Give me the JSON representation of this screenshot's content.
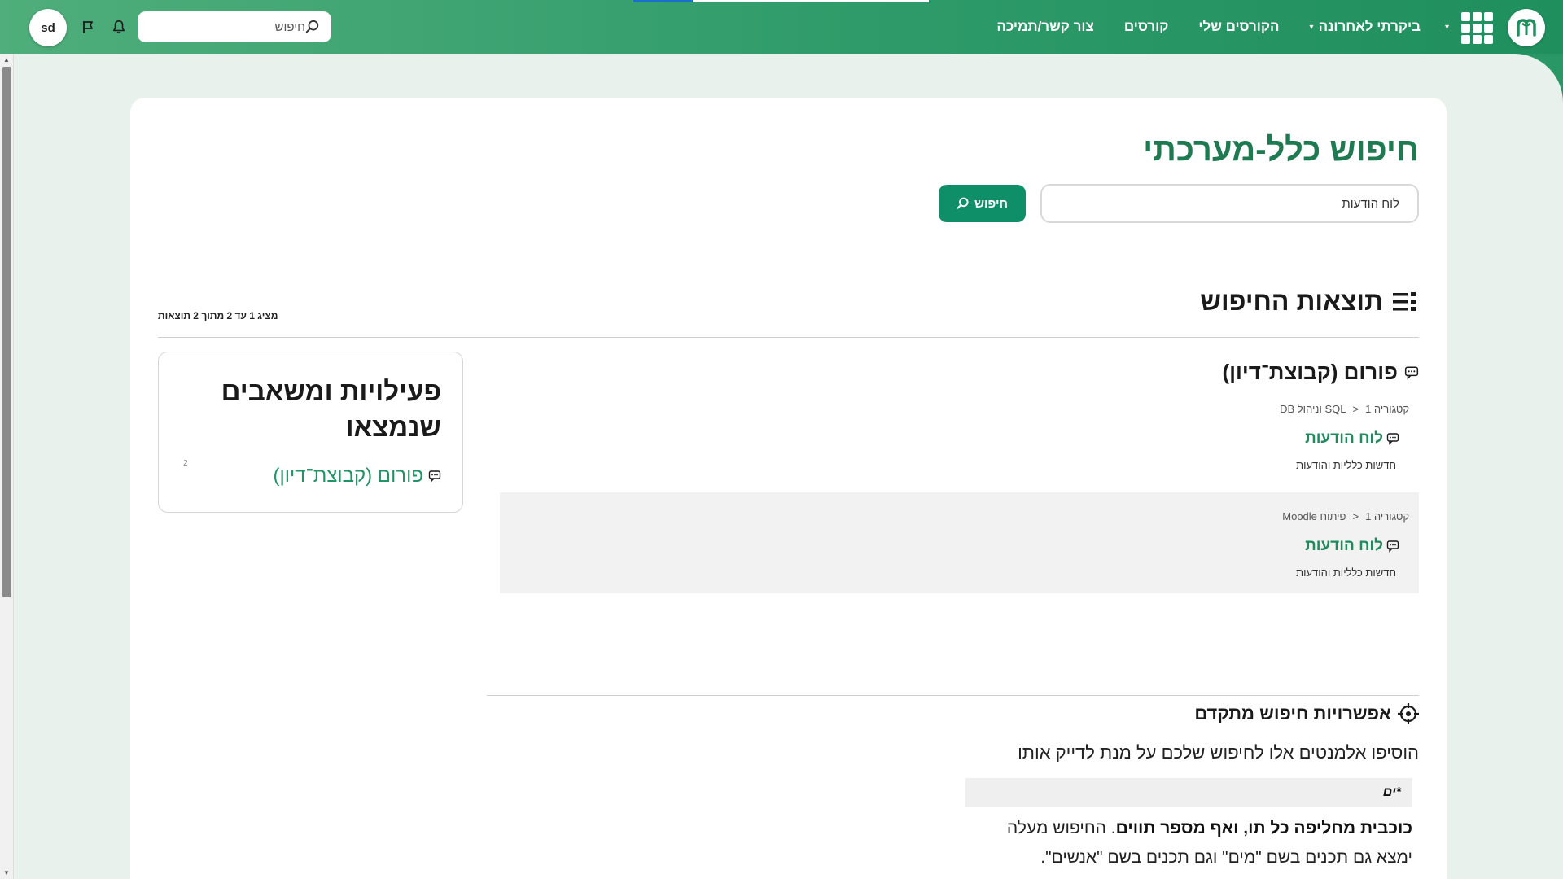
{
  "navbar": {
    "links": [
      {
        "label": "ביקרתי לאחרונה",
        "has_caret": true
      },
      {
        "label": "הקורסים שלי",
        "has_caret": false
      },
      {
        "label": "קורסים",
        "has_caret": false
      },
      {
        "label": "צור קשר/תמיכה",
        "has_caret": false
      }
    ],
    "search_placeholder": "חיפוש",
    "avatar_initials": "sd",
    "accent_color": "#2f9b6a"
  },
  "page": {
    "title": "חיפוש כלל-מערכתי",
    "search_value": "לוח הודעות",
    "search_button": "חיפוש"
  },
  "results": {
    "title": "תוצאות החיפוש",
    "count_text": "מציג 1 עד 2 מתוך 2 תוצאות",
    "group_heading": "פורום (קבוצת־דיון)",
    "items": [
      {
        "breadcrumb_category": "קטגוריה 1",
        "breadcrumb_course": "SQL וניהול DB",
        "title": "לוח הודעות",
        "description": "חדשות כלליות והודעות"
      },
      {
        "breadcrumb_category": "קטגוריה 1",
        "breadcrumb_course": "פיתוח Moodle",
        "title": "לוח הודעות",
        "description": "חדשות כלליות והודעות"
      }
    ]
  },
  "sidebar": {
    "title": "פעילויות ומשאבים שנמצאו",
    "item_label": "פורום (קבוצת־דיון)",
    "item_count": "2"
  },
  "advanced": {
    "title": "אפשרויות חיפוש מתקדם",
    "intro": "הוסיפו אלמנטים אלו לחיפוש שלכם על מנת לדייק אותו",
    "example": "*ים",
    "explain_bold": "כוכבית מחליפה כל תו, ואף מספר תווים",
    "explain_rest": ". החיפוש מעלה ימצא גם תכנים בשם \"מים\" וגם תכנים בשם \"אנשים\"."
  },
  "icons": {
    "logo": "moodle-logo-icon",
    "apps": "apps-grid-icon",
    "search": "search-icon",
    "notifications": "bell-icon",
    "flag": "flag-icon",
    "forum": "forum-icon",
    "list": "list-icon",
    "crosshair": "crosshair-icon"
  }
}
